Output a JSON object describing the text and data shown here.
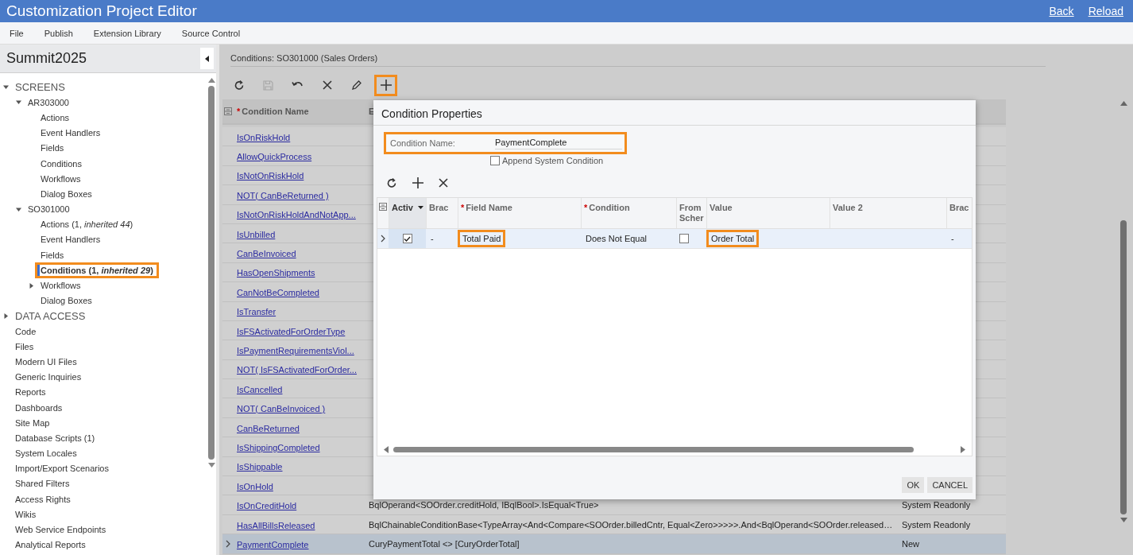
{
  "window": {
    "title": "Customization Project Editor",
    "links": [
      "Back",
      "Reload"
    ]
  },
  "menu": [
    "File",
    "Publish",
    "Extension Library",
    "Source Control"
  ],
  "sidebar": {
    "project": "Summit2025",
    "tree": [
      {
        "label": "SCREENS",
        "kind": "section",
        "expanded": true,
        "selected": false,
        "highlighted": false,
        "children": [
          {
            "label": "AR303000",
            "expanded": true,
            "selected": false,
            "highlighted": false,
            "children": [
              {
                "label": "Actions",
                "selected": false,
                "highlighted": false
              },
              {
                "label": "Event Handlers",
                "selected": false,
                "highlighted": false
              },
              {
                "label": "Fields",
                "selected": false,
                "highlighted": false
              },
              {
                "label": "Conditions",
                "selected": false,
                "highlighted": false
              },
              {
                "label": "Workflows",
                "selected": false,
                "highlighted": false
              },
              {
                "label": "Dialog Boxes",
                "selected": false,
                "highlighted": false
              }
            ]
          },
          {
            "label": "SO301000",
            "expanded": true,
            "selected": false,
            "highlighted": false,
            "children": [
              {
                "label": "Actions (1, *inherited 44*)",
                "selected": false,
                "highlighted": false
              },
              {
                "label": "Event Handlers",
                "selected": false,
                "highlighted": false
              },
              {
                "label": "Fields",
                "selected": false,
                "highlighted": false
              },
              {
                "label": "Conditions (1, *inherited 29*)",
                "selected": true,
                "highlighted": true
              },
              {
                "label": "Workflows",
                "expanded": false,
                "selected": false,
                "highlighted": false
              },
              {
                "label": "Dialog Boxes",
                "selected": false,
                "highlighted": false
              }
            ]
          }
        ]
      },
      {
        "label": "DATA ACCESS",
        "kind": "section",
        "expanded": false,
        "selected": false,
        "highlighted": false
      },
      {
        "label": "Code",
        "selected": false,
        "highlighted": false
      },
      {
        "label": "Files",
        "selected": false,
        "highlighted": false
      },
      {
        "label": "Modern UI Files",
        "selected": false,
        "highlighted": false
      },
      {
        "label": "Generic Inquiries",
        "selected": false,
        "highlighted": false
      },
      {
        "label": "Reports",
        "selected": false,
        "highlighted": false
      },
      {
        "label": "Dashboards",
        "selected": false,
        "highlighted": false
      },
      {
        "label": "Site Map",
        "selected": false,
        "highlighted": false
      },
      {
        "label": "Database Scripts (1)",
        "selected": false,
        "highlighted": false
      },
      {
        "label": "System Locales",
        "selected": false,
        "highlighted": false
      },
      {
        "label": "Import/Export Scenarios",
        "selected": false,
        "highlighted": false
      },
      {
        "label": "Shared Filters",
        "selected": false,
        "highlighted": false
      },
      {
        "label": "Access Rights",
        "selected": false,
        "highlighted": false
      },
      {
        "label": "Wikis",
        "selected": false,
        "highlighted": false
      },
      {
        "label": "Web Service Endpoints",
        "selected": false,
        "highlighted": false
      },
      {
        "label": "Analytical Reports",
        "selected": false,
        "highlighted": false
      }
    ]
  },
  "main": {
    "breadcrumb": "Conditions: SO301000 (Sales Orders)",
    "toolbar": [
      {
        "kind": "refresh",
        "disabled": false,
        "highlighted": false
      },
      {
        "kind": "save",
        "disabled": true,
        "highlighted": false
      },
      {
        "kind": "undo",
        "disabled": false,
        "highlighted": false
      },
      {
        "kind": "delete",
        "disabled": false,
        "highlighted": false
      },
      {
        "kind": "edit",
        "disabled": false,
        "highlighted": false
      },
      {
        "kind": "add",
        "disabled": false,
        "highlighted": true
      }
    ],
    "table": {
      "columns": [
        {
          "label": "Condition Name",
          "marker": "*"
        },
        {
          "label": "E"
        }
      ],
      "rows": [
        {
          "name": "IsOnRiskHold",
          "selected": false
        },
        {
          "name": "AllowQuickProcess",
          "selected": false
        },
        {
          "name": "IsNotOnRiskHold",
          "selected": false
        },
        {
          "name": "NOT( CanBeReturned )",
          "selected": false
        },
        {
          "name": "IsNotOnRiskHoldAndNotApp...",
          "selected": false
        },
        {
          "name": "IsUnbilled",
          "selected": false
        },
        {
          "name": "CanBeInvoiced",
          "selected": false
        },
        {
          "name": "HasOpenShipments",
          "selected": false
        },
        {
          "name": "CanNotBeCompleted",
          "selected": false
        },
        {
          "name": "IsTransfer",
          "selected": false
        },
        {
          "name": "IsFSActivatedForOrderType",
          "selected": false
        },
        {
          "name": "IsPaymentRequirementsViol...",
          "selected": false
        },
        {
          "name": "NOT( IsFSActivatedForOrder...",
          "selected": false
        },
        {
          "name": "IsCancelled",
          "selected": false
        },
        {
          "name": "NOT( CanBeInvoiced )",
          "selected": false
        },
        {
          "name": "CanBeReturned",
          "selected": false
        },
        {
          "name": "IsShippingCompleted",
          "selected": false
        },
        {
          "name": "IsShippable",
          "selected": false
        },
        {
          "name": "IsOnHold",
          "selected": false
        },
        {
          "name": "IsOnCreditHold",
          "expression": "BqlOperand<SOOrder.creditHold, IBqlBool>.IsEqual<True>",
          "status": "System Readonly",
          "selected": false
        },
        {
          "name": "HasAllBillsReleased",
          "expression": "BqlChainableConditionBase<TypeArray<And<Compare<SOOrder.billedCntr, Equal<Zero>>>>>.And<BqlOperand<SOOrder.released…",
          "status": "System Readonly",
          "selected": false
        },
        {
          "name": "PaymentComplete",
          "expression": "CuryPaymentTotal <> [CuryOrderTotal]",
          "status": "New",
          "selected": true
        }
      ]
    }
  },
  "dialog": {
    "title": "Condition Properties",
    "name_field": {
      "label": "Condition Name:",
      "value": "PaymentComplete",
      "highlighted": true
    },
    "append": {
      "label": "Append System Condition",
      "checked": false
    },
    "toolbar": [
      {
        "kind": "refresh"
      },
      {
        "kind": "add"
      },
      {
        "kind": "delete"
      }
    ],
    "grid": {
      "columns": [
        {
          "label": "Activ",
          "sorted": true
        },
        {
          "label": "Brac",
          "sorted": false
        },
        {
          "label": "Field Name",
          "marker": "*",
          "sorted": false
        },
        {
          "label": "Condition",
          "marker": "*",
          "sorted": false
        },
        {
          "label": "From Scher",
          "sorted": false
        },
        {
          "label": "Value",
          "sorted": false
        },
        {
          "label": "Value 2",
          "sorted": false
        },
        {
          "label": "Brac",
          "sorted": false
        }
      ],
      "rows": [
        {
          "selected": true,
          "cells": [
            {
              "kind": "checkbox",
              "checked": true
            },
            {
              "kind": "text",
              "text": "-",
              "highlighted": false
            },
            {
              "kind": "text",
              "text": "Total Paid",
              "highlighted": true
            },
            {
              "kind": "text",
              "text": "Does Not Equal",
              "highlighted": false
            },
            {
              "kind": "checkbox",
              "checked": false
            },
            {
              "kind": "text",
              "text": "Order Total",
              "highlighted": true
            },
            {
              "kind": "empty"
            },
            {
              "kind": "text",
              "text": "-",
              "highlighted": false
            }
          ]
        }
      ]
    },
    "buttons": [
      "OK",
      "CANCEL"
    ]
  }
}
